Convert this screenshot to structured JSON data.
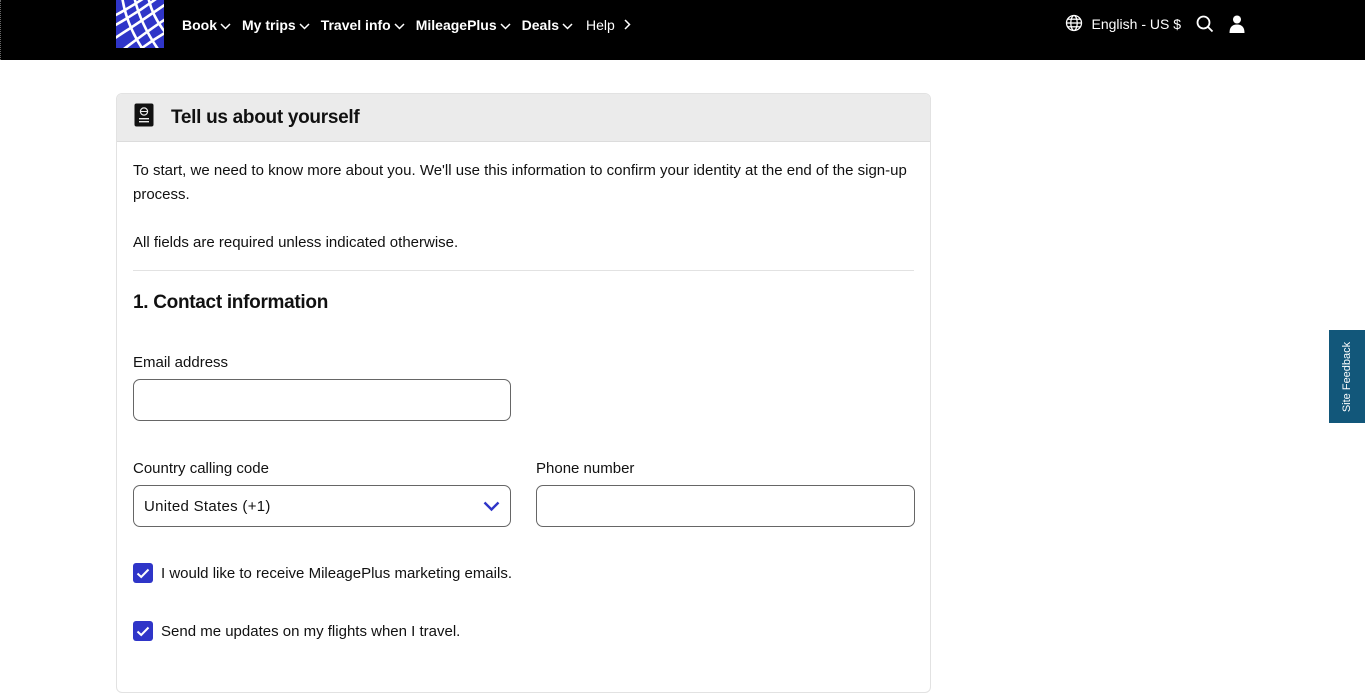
{
  "header": {
    "logo_icon": "globe-logo-icon",
    "nav": [
      {
        "label": "Book"
      },
      {
        "label": "My trips"
      },
      {
        "label": "Travel info"
      },
      {
        "label": "MileagePlus"
      },
      {
        "label": "Deals"
      }
    ],
    "help_label": "Help",
    "language_label": "English - US $",
    "icons": {
      "language": "globe-icon",
      "search": "search-icon",
      "account": "user-icon"
    }
  },
  "card": {
    "title": "Tell us about yourself",
    "header_icon": "passport-icon",
    "intro": "To start, we need to know more about you. We'll use this information to confirm your identity at the end of the sign-up process.",
    "required_note": "All fields are required unless indicated otherwise.",
    "section_title": "1. Contact information",
    "email": {
      "label": "Email address",
      "value": "",
      "placeholder": ""
    },
    "country": {
      "label": "Country calling code",
      "selected": "United States (+1)"
    },
    "phone": {
      "label": "Phone number",
      "value": "",
      "placeholder": ""
    },
    "checkboxes": [
      {
        "label": "I would like to receive MileagePlus marketing emails.",
        "checked": true
      },
      {
        "label": "Send me updates on my flights when I travel.",
        "checked": true
      }
    ]
  },
  "feedback_tab": {
    "label": "Site Feedback"
  },
  "colors": {
    "brand_blue": "#2f35c8",
    "feedback_teal": "#12577a",
    "header_bg": "#000000"
  }
}
